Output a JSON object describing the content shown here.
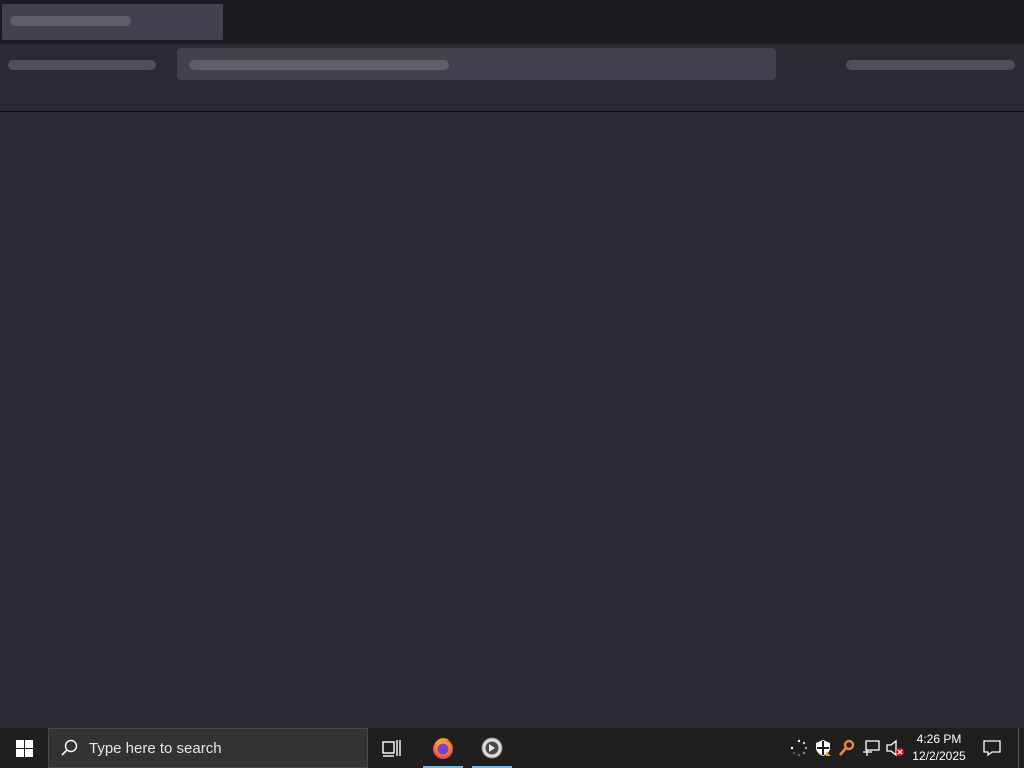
{
  "taskbar": {
    "search_placeholder": "Type here to search",
    "clock_time": "4:26 PM",
    "clock_date": "12/2/2025",
    "pinned_apps": [
      {
        "icon": "firefox-icon",
        "running": true
      },
      {
        "icon": "app-icon",
        "running": true
      }
    ],
    "tray_icons": [
      "loading-icon",
      "security-shield-icon",
      "key-icon",
      "network-icon",
      "volume-muted-icon"
    ]
  },
  "colors": {
    "background": "#2b2a33",
    "tabbar": "#1c1b22",
    "field": "#42414d",
    "taskbar": "#1f1f1f",
    "accent": "#76b9ed"
  }
}
